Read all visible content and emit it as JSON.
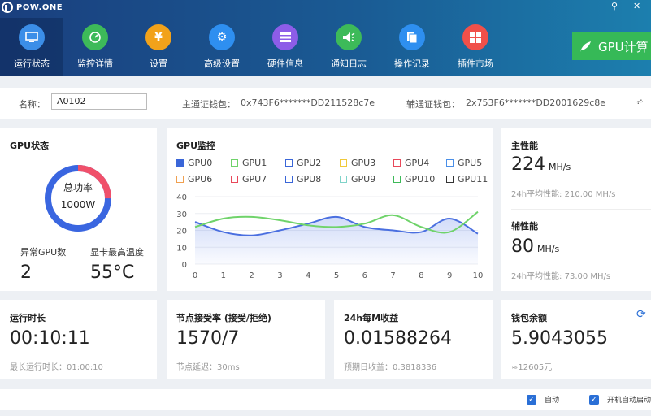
{
  "app": {
    "brand": "POW.ONE"
  },
  "window": {
    "pin_icon": "pin-icon",
    "close_icon": "close-icon"
  },
  "nav": [
    {
      "label": "运行状态",
      "icon": "monitor-icon",
      "color": "#3b8ee8"
    },
    {
      "label": "监控详情",
      "icon": "gauge-icon",
      "color": "#3dba59"
    },
    {
      "label": "设置",
      "icon": "coin-icon",
      "color": "#f2a21a"
    },
    {
      "label": "高级设置",
      "icon": "gear-icon",
      "color": "#2e8ff0"
    },
    {
      "label": "硬件信息",
      "icon": "server-icon",
      "color": "#8d5de8"
    },
    {
      "label": "通知日志",
      "icon": "speaker-icon",
      "color": "#3dba59"
    },
    {
      "label": "操作记录",
      "icon": "document-icon",
      "color": "#2e8ff0"
    },
    {
      "label": "插件市场",
      "icon": "grid-icon",
      "color": "#f0504a"
    }
  ],
  "gpu_button": {
    "label": "GPU计算"
  },
  "namebar": {
    "name_label": "名称：",
    "name_value": "A0102",
    "main_wallet_label": "主通证钱包：",
    "main_wallet": "0x743F6*******DD211528c7e",
    "aux_wallet_label": "辅通证钱包：",
    "aux_wallet": "2x753F6*******DD2001629c8e"
  },
  "gpu_status": {
    "title": "GPU状态",
    "power_label": "总功率",
    "power_value": "1000W",
    "abnormal_label": "异常GPU数",
    "abnormal_value": "2",
    "temp_label": "显卡最高温度",
    "temp_value": "55°C",
    "ring_fraction": 0.75
  },
  "gpu_monitor": {
    "title": "GPU监控",
    "legend": [
      {
        "name": "GPU0",
        "color": "#3a66d8",
        "checked": true
      },
      {
        "name": "GPU1",
        "color": "#6fd36a"
      },
      {
        "name": "GPU2",
        "color": "#3a66d8"
      },
      {
        "name": "GPU3",
        "color": "#f0c93a"
      },
      {
        "name": "GPU4",
        "color": "#e8485a"
      },
      {
        "name": "GPU5",
        "color": "#4a8fe8"
      },
      {
        "name": "GPU6",
        "color": "#f0a050"
      },
      {
        "name": "GPU7",
        "color": "#e8485a"
      },
      {
        "name": "GPU8",
        "color": "#3a66d8"
      },
      {
        "name": "GPU9",
        "color": "#7fd3c9"
      },
      {
        "name": "GPU10",
        "color": "#3dba59"
      },
      {
        "name": "GPU11",
        "color": "#333333"
      }
    ]
  },
  "chart_data": {
    "type": "line",
    "x": [
      0,
      1,
      2,
      3,
      4,
      5,
      6,
      7,
      8,
      9,
      10
    ],
    "ylim": [
      0,
      40
    ],
    "yticks": [
      0,
      10,
      20,
      30,
      40
    ],
    "series": [
      {
        "name": "GPU0",
        "color": "#4a6fe0",
        "fill": true,
        "values": [
          25,
          19,
          17,
          20,
          24,
          28,
          22,
          20,
          19,
          27,
          18
        ]
      },
      {
        "name": "GPU1",
        "color": "#6fd36a",
        "fill": false,
        "values": [
          22,
          27,
          28,
          26,
          23,
          22,
          24,
          29,
          22,
          19,
          31
        ]
      }
    ]
  },
  "main_perf": {
    "title": "主性能",
    "value": "224",
    "unit": "MH/s",
    "avg": "24h平均性能: 210.00 MH/s"
  },
  "aux_perf": {
    "title": "辅性能",
    "value": "80",
    "unit": "MH/s",
    "avg": "24h平均性能: 73.00 MH/s"
  },
  "runtime": {
    "title": "运行时长",
    "value": "00:10:11",
    "sub": "最长运行时长：01:00:10"
  },
  "accept": {
    "title": "节点接受率 (接受/拒绝)",
    "value": "1570/7",
    "sub": "节点延迟：30ms"
  },
  "income": {
    "title": "24h每M收益",
    "value": "0.01588264",
    "sub": "预期日收益：0.3818336"
  },
  "wallet": {
    "title": "钱包余额",
    "value": "5.9043055",
    "sub": "≈12605元",
    "refresh_icon": "refresh-icon"
  },
  "footer": {
    "auto_label": "自动",
    "boot_label": "开机自动启动"
  }
}
